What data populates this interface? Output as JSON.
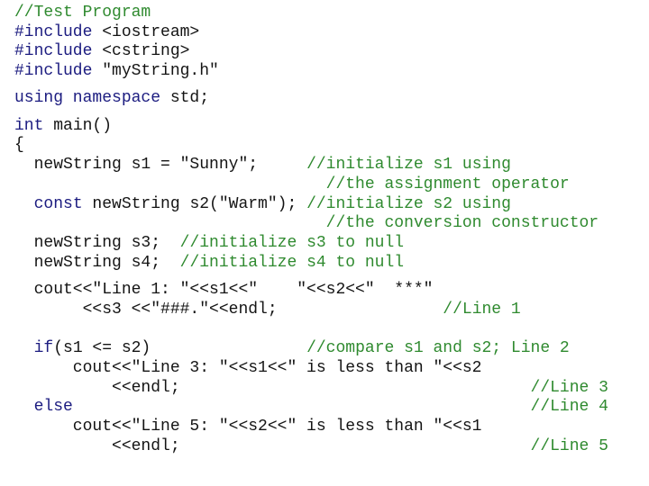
{
  "code": {
    "colors": {
      "keyword": "#1c1c80",
      "comment": "#2f8a2f",
      "text": "#141414"
    },
    "lines": [
      [
        {
          "t": "cm",
          "s": "//Test Program"
        }
      ],
      [
        {
          "t": "kw",
          "s": "#include "
        },
        {
          "t": "tx",
          "s": "<iostream>"
        }
      ],
      [
        {
          "t": "kw",
          "s": "#include "
        },
        {
          "t": "tx",
          "s": "<cstring>"
        }
      ],
      [
        {
          "t": "kw",
          "s": "#include "
        },
        {
          "t": "tx",
          "s": "\"myString.h\""
        }
      ],
      [
        {
          "t": "kw",
          "s": "using namespace "
        },
        {
          "t": "tx",
          "s": "std;"
        }
      ],
      [
        {
          "t": "kw",
          "s": "int "
        },
        {
          "t": "tx",
          "s": "main()"
        }
      ],
      [
        {
          "t": "tx",
          "s": "{"
        }
      ],
      [
        {
          "t": "tx",
          "s": "  newString s1 = \"Sunny\";"
        },
        {
          "t": "tx",
          "s": "     "
        },
        {
          "t": "cm",
          "s": "//initialize s1 using"
        }
      ],
      [
        {
          "t": "tx",
          "s": "                                "
        },
        {
          "t": "cm",
          "s": "//the assignment operator"
        }
      ],
      [
        {
          "t": "tx",
          "s": "  "
        },
        {
          "t": "kw",
          "s": "const "
        },
        {
          "t": "tx",
          "s": "newString s2(\"Warm\"); "
        },
        {
          "t": "cm",
          "s": "//initialize s2 using"
        }
      ],
      [
        {
          "t": "tx",
          "s": "                                "
        },
        {
          "t": "cm",
          "s": "//the conversion constructor"
        }
      ],
      [
        {
          "t": "tx",
          "s": "  newString s3;  "
        },
        {
          "t": "cm",
          "s": "//initialize s3 to null"
        }
      ],
      [
        {
          "t": "tx",
          "s": "  newString s4;  "
        },
        {
          "t": "cm",
          "s": "//initialize s4 to null"
        }
      ],
      [
        {
          "t": "tx",
          "s": "  cout<<\"Line 1: \"<<s1<<\"    \"<<s2<<\"  ***\""
        }
      ],
      [
        {
          "t": "tx",
          "s": "       <<s3 <<\"###.\"<<endl;"
        },
        {
          "t": "tx",
          "s": "                 "
        },
        {
          "t": "cm",
          "s": "//Line 1"
        }
      ],
      [
        {
          "t": "tx",
          "s": "  "
        },
        {
          "t": "kw",
          "s": "if"
        },
        {
          "t": "tx",
          "s": "(s1 <= s2)"
        },
        {
          "t": "tx",
          "s": "                "
        },
        {
          "t": "cm",
          "s": "//compare s1 and s2; Line 2"
        }
      ],
      [
        {
          "t": "tx",
          "s": "      cout<<\"Line 3: \"<<s1<<\" is less than \"<<s2"
        }
      ],
      [
        {
          "t": "tx",
          "s": "          <<endl;"
        },
        {
          "t": "tx",
          "s": "                                    "
        },
        {
          "t": "cm",
          "s": "//Line 3"
        }
      ],
      [
        {
          "t": "tx",
          "s": "  "
        },
        {
          "t": "kw",
          "s": "else"
        },
        {
          "t": "tx",
          "s": "                                               "
        },
        {
          "t": "cm",
          "s": "//Line 4"
        }
      ],
      [
        {
          "t": "tx",
          "s": "      cout<<\"Line 5: \"<<s2<<\" is less than \"<<s1"
        }
      ],
      [
        {
          "t": "tx",
          "s": "          <<endl;"
        },
        {
          "t": "tx",
          "s": "                                    "
        },
        {
          "t": "cm",
          "s": "//Line 5"
        }
      ]
    ]
  }
}
